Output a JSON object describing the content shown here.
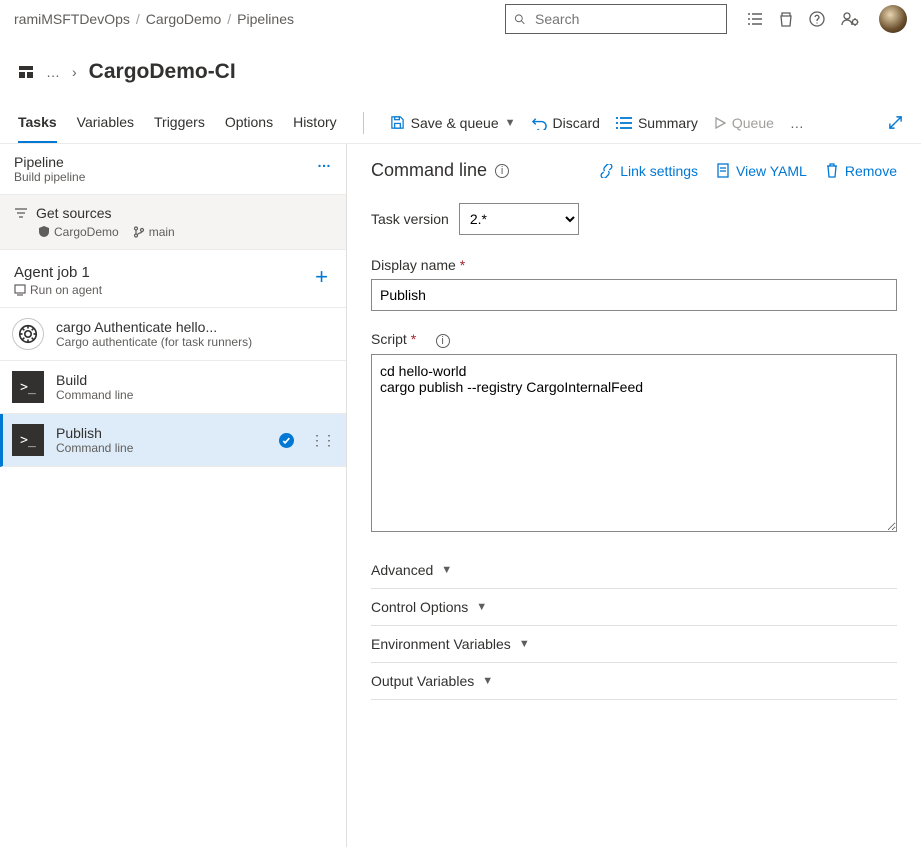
{
  "breadcrumbs": [
    "ramiMSFTDevOps",
    "CargoDemo",
    "Pipelines"
  ],
  "search": {
    "placeholder": "Search"
  },
  "page_title": "CargoDemo-CI",
  "tabs": {
    "items": [
      "Tasks",
      "Variables",
      "Triggers",
      "Options",
      "History"
    ],
    "active": "Tasks"
  },
  "toolbar": {
    "save_queue": "Save & queue",
    "discard": "Discard",
    "summary": "Summary",
    "queue": "Queue"
  },
  "left": {
    "pipeline": {
      "title": "Pipeline",
      "subtitle": "Build pipeline"
    },
    "sources": {
      "title": "Get sources",
      "repo": "CargoDemo",
      "branch": "main"
    },
    "agent": {
      "title": "Agent job 1",
      "subtitle": "Run on agent"
    },
    "tasks": [
      {
        "id": "cargo-auth",
        "name": "cargo Authenticate hello...",
        "sub": "Cargo authenticate (for task runners)",
        "icon": "cargo"
      },
      {
        "id": "build",
        "name": "Build",
        "sub": "Command line",
        "icon": "cli"
      },
      {
        "id": "publish",
        "name": "Publish",
        "sub": "Command line",
        "icon": "cli",
        "selected": true
      }
    ]
  },
  "right": {
    "panel_title": "Command line",
    "links": {
      "link_settings": "Link settings",
      "view_yaml": "View YAML",
      "remove": "Remove"
    },
    "task_version_label": "Task version",
    "task_version": "2.*",
    "display_name_label": "Display name",
    "display_name": "Publish",
    "script_label": "Script",
    "script": "cd hello-world\ncargo publish --registry CargoInternalFeed",
    "sections": [
      "Advanced",
      "Control Options",
      "Environment Variables",
      "Output Variables"
    ]
  }
}
